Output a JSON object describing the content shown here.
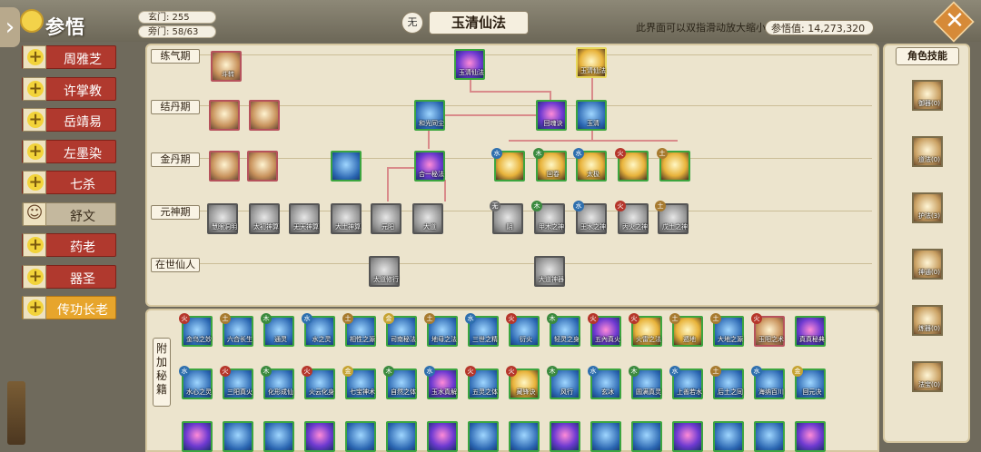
{
  "header": {
    "app_title": "参悟",
    "stat_xuan": "玄门: 255",
    "stat_pang": "旁门: 58/63",
    "element_badge": "无",
    "tree_title": "玉清仙法",
    "hint": "此界面可以双指滑动放大缩小",
    "points": "参悟值: 14,273,320"
  },
  "sidebar": {
    "items": [
      {
        "label": "周雅芝",
        "state": "red"
      },
      {
        "label": "许掌教",
        "state": "red"
      },
      {
        "label": "岳靖易",
        "state": "red"
      },
      {
        "label": "左墨染",
        "state": "red"
      },
      {
        "label": "七杀",
        "state": "red"
      },
      {
        "label": "舒文",
        "state": "neutral"
      },
      {
        "label": "药老",
        "state": "red"
      },
      {
        "label": "器圣",
        "state": "red"
      },
      {
        "label": "传功长老",
        "state": "active"
      }
    ]
  },
  "tree": {
    "rows": [
      "练气期",
      "结丹期",
      "金丹期",
      "元神期",
      "在世仙人"
    ],
    "nodes": [
      {
        "label": "斗转",
        "style": "pink"
      },
      {
        "label": "玉清仙法",
        "style": "orb"
      },
      {
        "label": "玉清仙法",
        "style": "gold"
      },
      {
        "label": "",
        "style": "pink"
      },
      {
        "label": "",
        "style": "pink"
      },
      {
        "label": "和光同尘",
        "style": "blue"
      },
      {
        "label": "回魂诀",
        "style": "orb"
      },
      {
        "label": "玉清",
        "style": "blue"
      },
      {
        "label": "",
        "style": "pink"
      },
      {
        "label": "",
        "style": "pink"
      },
      {
        "label": "",
        "style": "blue"
      },
      {
        "label": "合一秘法",
        "style": "orb"
      },
      {
        "label": "",
        "style": "gold"
      },
      {
        "label": "回春",
        "style": "gold"
      },
      {
        "label": "太极",
        "style": "gold"
      },
      {
        "label": "",
        "style": "gold"
      },
      {
        "label": "",
        "style": "gold"
      },
      {
        "label": "慧眼洞明",
        "style": "locked"
      },
      {
        "label": "太初神算",
        "style": "locked"
      },
      {
        "label": "无天神算",
        "style": "locked"
      },
      {
        "label": "大土神算",
        "style": "locked"
      },
      {
        "label": "元阳",
        "style": "locked"
      },
      {
        "label": "大道",
        "style": "locked"
      },
      {
        "label": "阴",
        "style": "locked"
      },
      {
        "label": "甲木之神",
        "style": "locked"
      },
      {
        "label": "王水之神",
        "style": "locked"
      },
      {
        "label": "丙火之神",
        "style": "locked"
      },
      {
        "label": "戊土之神",
        "style": "locked"
      },
      {
        "label": "太道修行",
        "style": "locked"
      },
      {
        "label": "大道神器",
        "style": "locked"
      }
    ]
  },
  "role_panel": {
    "title": "角色技能",
    "items": [
      {
        "label": "御器(0)"
      },
      {
        "label": "道法(0)"
      },
      {
        "label": "护法(3)"
      },
      {
        "label": "神通(0)"
      },
      {
        "label": "炼器(0)"
      },
      {
        "label": "法宝(0)"
      }
    ]
  },
  "extra": {
    "label": "附加秘籍",
    "row1": [
      {
        "label": "金乌之妙",
        "elem": "火",
        "style": "blue"
      },
      {
        "label": "六合长生",
        "elem": "土",
        "style": "blue"
      },
      {
        "label": "通灵",
        "elem": "木",
        "style": "blue"
      },
      {
        "label": "水之灵",
        "elem": "水",
        "style": "blue"
      },
      {
        "label": "相性之源",
        "elem": "土",
        "style": "blue"
      },
      {
        "label": "司南秘法",
        "elem": "金",
        "style": "blue"
      },
      {
        "label": "地母之法",
        "elem": "土",
        "style": "blue"
      },
      {
        "label": "三世之精",
        "elem": "水",
        "style": "blue"
      },
      {
        "label": "衍火",
        "elem": "火",
        "style": "blue"
      },
      {
        "label": "轻灵之身",
        "elem": "木",
        "style": "blue"
      },
      {
        "label": "五內真火",
        "elem": "火",
        "style": "orb"
      },
      {
        "label": "火雷之法",
        "elem": "火",
        "style": "gold"
      },
      {
        "label": "遁地",
        "elem": "土",
        "style": "gold"
      },
      {
        "label": "大地之源",
        "elem": "土",
        "style": "blue"
      },
      {
        "label": "玉阳之术",
        "elem": "火",
        "style": "pink"
      },
      {
        "label": "真真秘典",
        "elem": "",
        "style": "orb"
      }
    ],
    "row2": [
      {
        "label": "水心之灵",
        "elem": "水",
        "style": "blue"
      },
      {
        "label": "三阳真火",
        "elem": "火",
        "style": "blue"
      },
      {
        "label": "化形成仙",
        "elem": "木",
        "style": "blue"
      },
      {
        "label": "火云化身",
        "elem": "火",
        "style": "blue"
      },
      {
        "label": "七宝神术",
        "elem": "金",
        "style": "blue"
      },
      {
        "label": "自然之体",
        "elem": "木",
        "style": "blue"
      },
      {
        "label": "玉水真解",
        "elem": "水",
        "style": "orb"
      },
      {
        "label": "五灵之体",
        "elem": "火",
        "style": "blue"
      },
      {
        "label": "藏锋诀",
        "elem": "火",
        "style": "gold"
      },
      {
        "label": "风行",
        "elem": "木",
        "style": "blue"
      },
      {
        "label": "玄冰",
        "elem": "水",
        "style": "blue"
      },
      {
        "label": "圆满真灵",
        "elem": "木",
        "style": "blue"
      },
      {
        "label": "上善若水",
        "elem": "水",
        "style": "blue"
      },
      {
        "label": "后土之同",
        "elem": "土",
        "style": "blue"
      },
      {
        "label": "海纳百川",
        "elem": "水",
        "style": "blue"
      },
      {
        "label": "回元决",
        "elem": "金",
        "style": "blue"
      }
    ]
  }
}
